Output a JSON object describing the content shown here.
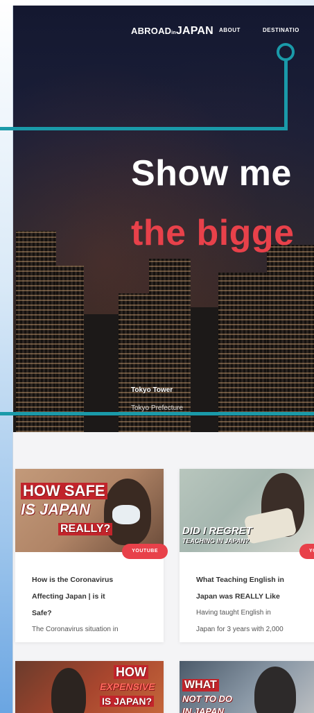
{
  "nav": {
    "logo_left": "ABROAD",
    "logo_mid": "in",
    "logo_right": "JAPAN",
    "about": "ABOUT",
    "destinations": "DESTINATIO"
  },
  "hero": {
    "title_line1": "Show me",
    "title_line2": "the bigge",
    "caption_place": "Tokyo Tower",
    "caption_region": "Tokyo Prefecture"
  },
  "cards": [
    {
      "thumb_line1": "HOW SAFE",
      "thumb_line2": "IS JAPAN",
      "thumb_line3": "REALLY?",
      "badge": "YOUTUBE",
      "title_l1": "How is the Coronavirus",
      "title_l2": "Affecting Japan | is it",
      "title_l3": "Safe?",
      "desc": "The Coronavirus situation in"
    },
    {
      "thumb_line1": "DID I REGRET",
      "thumb_line2": "TEACHING IN JAPAN?",
      "badge": "YOUTU",
      "title_l1": "What Teaching English in",
      "title_l2": "Japan was REALLY Like",
      "desc_l1": "Having taught English in",
      "desc_l2": "Japan for 3 years with 2,000"
    },
    {
      "thumb_line1": "HOW",
      "thumb_line2": "EXPENSIVE",
      "thumb_line3": "IS JAPAN?"
    },
    {
      "thumb_line1": "WHAT",
      "thumb_line2": "NOT TO DO",
      "thumb_line3": "IN JAPAN"
    }
  ],
  "colors": {
    "accent": "#e8414a",
    "annotation": "#1a9aa9"
  }
}
